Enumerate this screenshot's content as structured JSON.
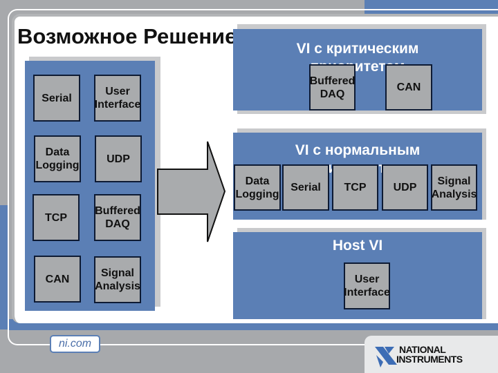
{
  "slide_title": "Возможное Решение",
  "left_box": {
    "tiles": [
      "Serial",
      "User\nInterface",
      "Data\nLogging",
      "UDP",
      "TCP",
      "Buffered\nDAQ",
      "CAN",
      "Signal\nAnalysis"
    ]
  },
  "critical_box": {
    "title": "VI с критическим",
    "subtitle": "приоритетом",
    "tiles": [
      "Buffered\nDAQ",
      "CAN"
    ]
  },
  "normal_box": {
    "title": "VI с нормальным",
    "subtitle": "приоритетом",
    "tiles": [
      "Data\nLogging",
      "Serial",
      "TCP",
      "UDP",
      "Signal\nAnalysis"
    ]
  },
  "host_box": {
    "title": "Host VI",
    "tiles": [
      "User\nInterface"
    ]
  },
  "footer": {
    "url": "ni.com",
    "logo_line1": "NATIONAL",
    "logo_line2": "INSTRUMENTS"
  },
  "colors": {
    "accent_blue": "#5b7fb5",
    "tile_gray": "#a9abad",
    "background_gray": "#a7a9ac"
  }
}
